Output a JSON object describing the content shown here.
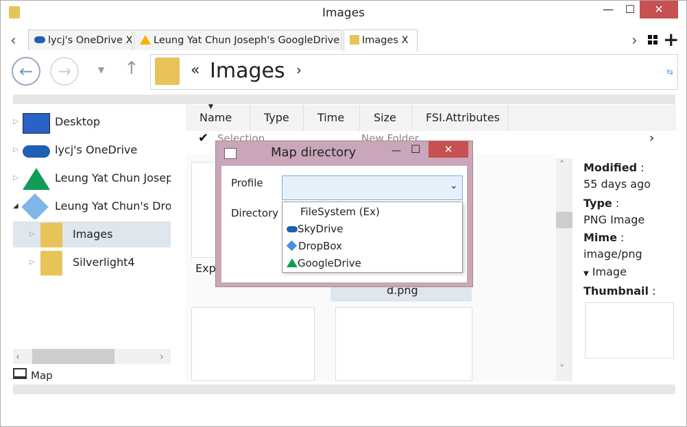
{
  "window": {
    "title": "Images",
    "minimize": "—",
    "maximize": "☐",
    "close": "✕"
  },
  "tabs": [
    {
      "label": "lycj's OneDrive X"
    },
    {
      "label": "Leung Yat Chun Joseph's GoogleDrive X"
    },
    {
      "label": "Images X"
    }
  ],
  "tabbar": {
    "left_arrow": "‹",
    "right_arrow": "›",
    "add": "+"
  },
  "address": {
    "prefix": "«",
    "current": "Images",
    "chevron": "›"
  },
  "tree": {
    "items": [
      {
        "label": "Desktop"
      },
      {
        "label": "lycj's OneDrive"
      },
      {
        "label": "Leung Yat Chun Joseph"
      },
      {
        "label": "Leung Yat Chun's Drop"
      },
      {
        "label": "Images"
      },
      {
        "label": "Silverlight4"
      }
    ],
    "map_label": "Map"
  },
  "columns": [
    "Name",
    "Type",
    "Time",
    "Size",
    "FSI.Attributes"
  ],
  "toolbar": {
    "selection": "Selection",
    "new_folder": "New Folder"
  },
  "files": {
    "item1_label": "Expl",
    "item2_label": "d.png"
  },
  "properties": {
    "modified_label": "Modified",
    "modified_value": "55 days ago",
    "type_label": "Type",
    "type_value": "PNG Image",
    "mime_label": "Mime",
    "mime_value": "image/png",
    "image_toggle": "Image",
    "thumbnail_label": "Thumbnail"
  },
  "dialog": {
    "title": "Map directory",
    "profile_label": "Profile",
    "directory_label": "Directory",
    "options": [
      "FileSystem (Ex)",
      "SkyDrive",
      "DropBox",
      "GoogleDrive"
    ]
  },
  "colors": {
    "accent": "#c75050",
    "selection": "#dfe6ee",
    "dialog_frame": "#c9a6b9"
  }
}
